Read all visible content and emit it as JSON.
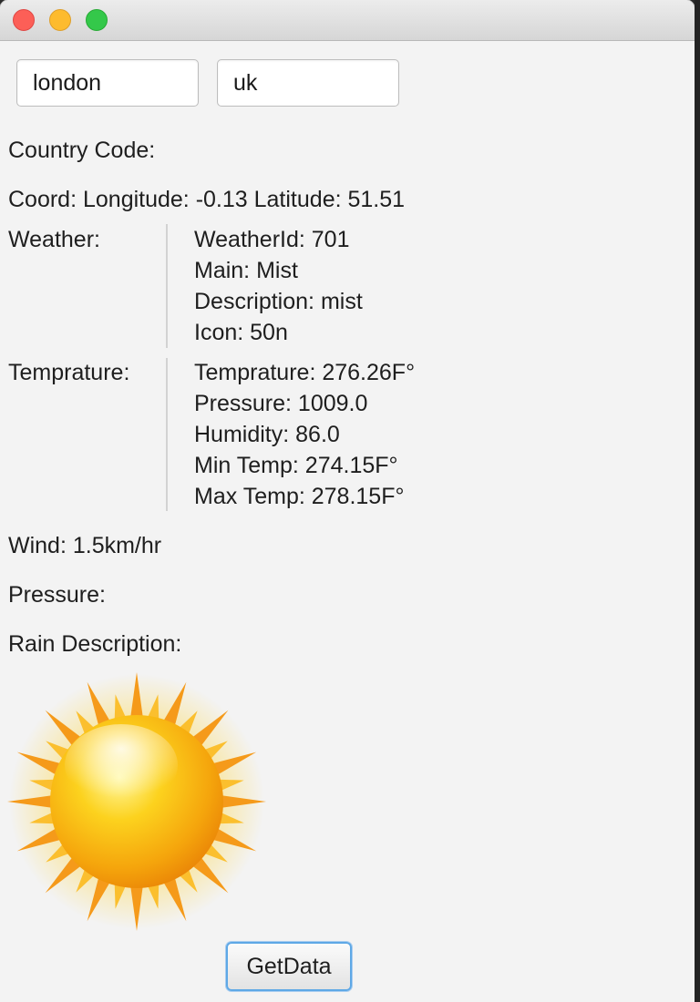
{
  "inputs": {
    "city_value": "london",
    "country_value": "uk"
  },
  "labels": {
    "country_code": "Country Code:",
    "coord": "Coord: Longitude: -0.13 Latitude: 51.51",
    "weather": "Weather:",
    "temprature": "Temprature:",
    "wind": "Wind: 1.5km/hr",
    "pressure": "Pressure:",
    "rain_description": "Rain Description:"
  },
  "weather": {
    "weather_id": "WeatherId: 701",
    "main": "Main: Mist",
    "description": "Description: mist",
    "icon": "Icon: 50n"
  },
  "temprature": {
    "temprature": "Temprature: 276.26F°",
    "pressure": "Pressure: 1009.0",
    "humidity": "Humidity: 86.0",
    "min_temp": "Min Temp: 274.15F°",
    "max_temp": "Max Temp: 278.15F°"
  },
  "button": {
    "get_data": "GetData"
  },
  "icons": {
    "weather_image": "sun-icon"
  },
  "colors": {
    "window_bg": "#f3f3f3",
    "close": "#fc5f57",
    "minimize": "#fdbb2e",
    "maximize": "#34c84a",
    "focus_ring": "#5ea8e6"
  }
}
